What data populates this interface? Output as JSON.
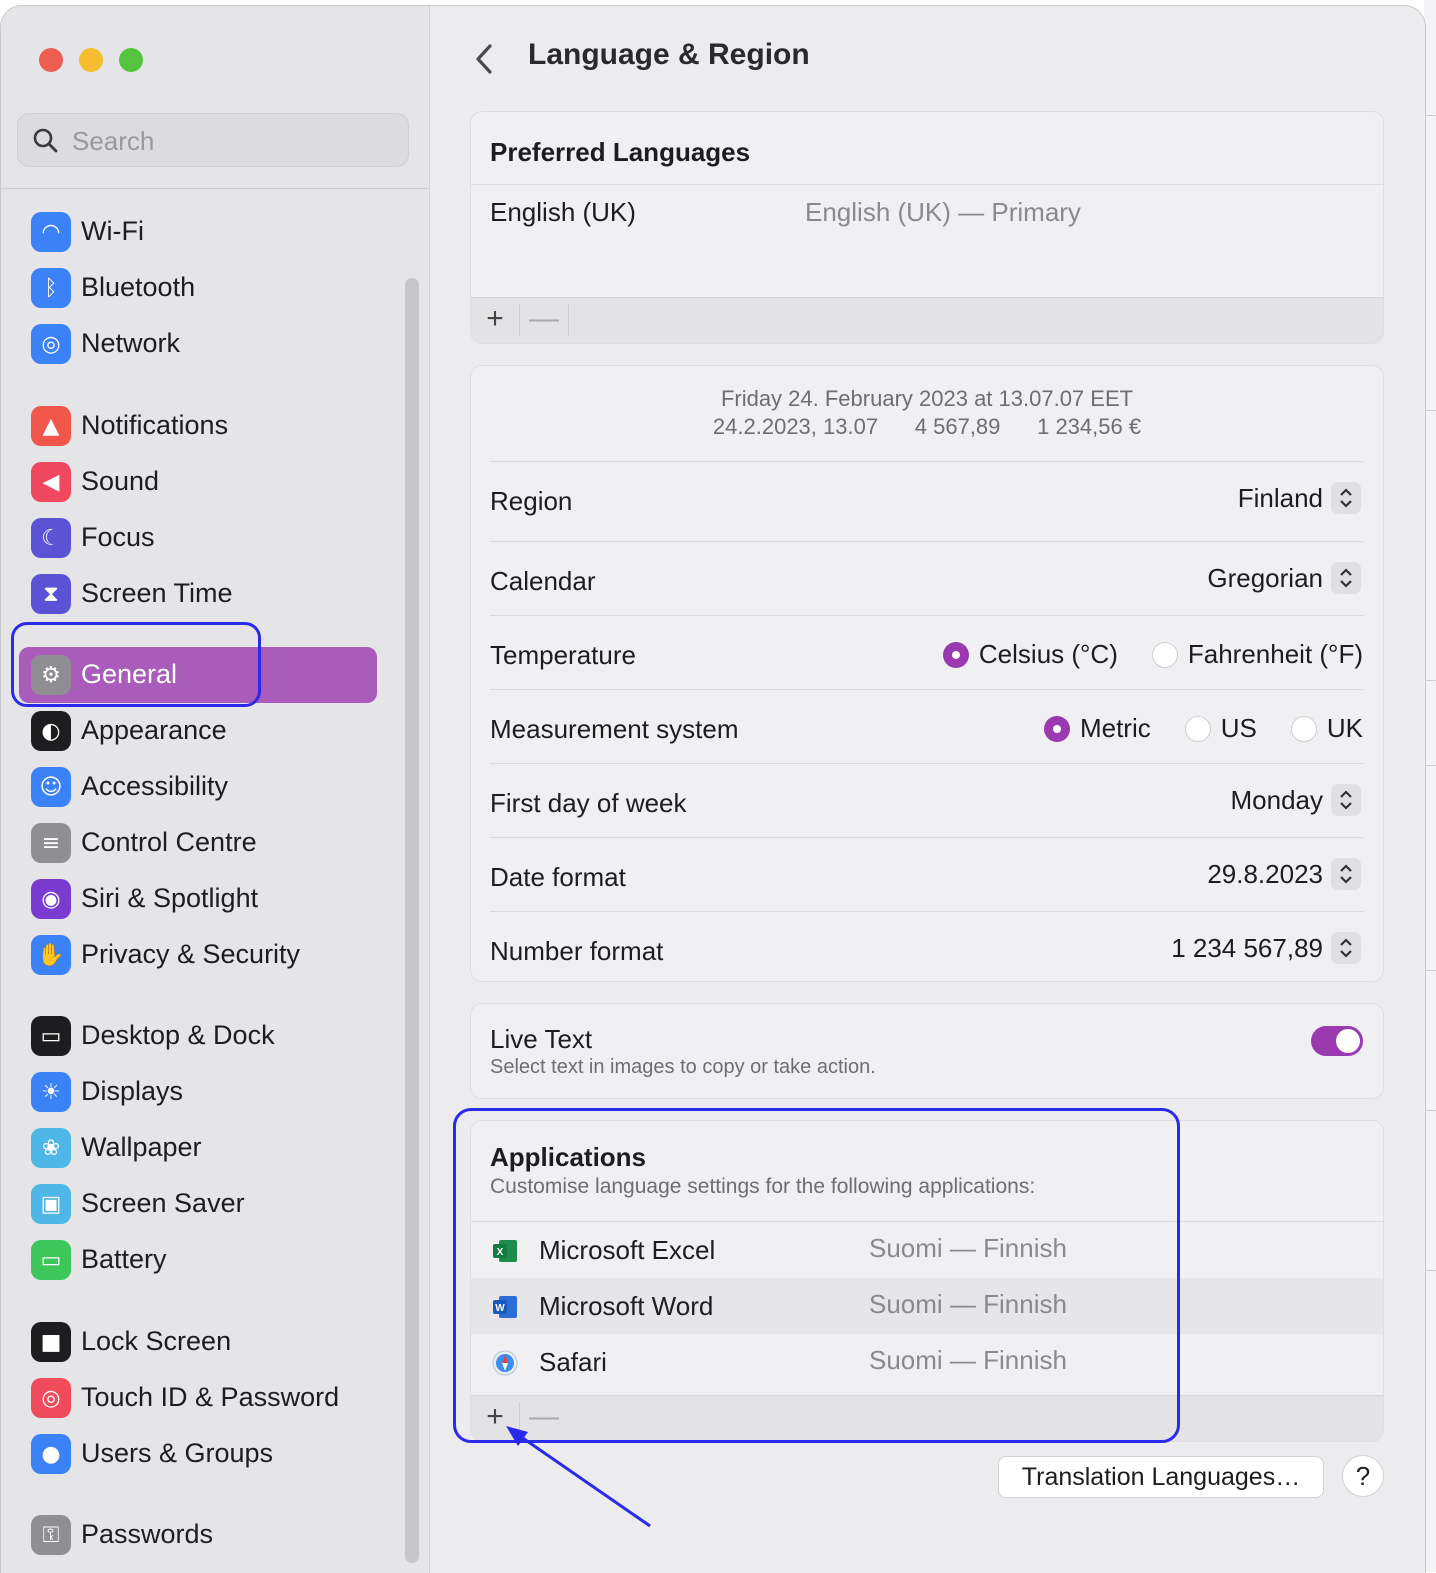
{
  "window": {
    "traffic_lights": {
      "close": "#ee5d54",
      "minimize": "#f5bd2f",
      "maximize": "#56c340"
    }
  },
  "sidebar": {
    "search_placeholder": "Search",
    "items": [
      {
        "label": "Wi-Fi",
        "icon": "wifi-icon",
        "color": "#3b82f6"
      },
      {
        "label": "Bluetooth",
        "icon": "bluetooth-icon",
        "color": "#3b82f6"
      },
      {
        "label": "Network",
        "icon": "globe-icon",
        "color": "#3b82f6"
      },
      {
        "label": "Notifications",
        "icon": "bell-icon",
        "color": "#f0564a"
      },
      {
        "label": "Sound",
        "icon": "speaker-icon",
        "color": "#f0485f"
      },
      {
        "label": "Focus",
        "icon": "moon-icon",
        "color": "#5b53d6"
      },
      {
        "label": "Screen Time",
        "icon": "hourglass-icon",
        "color": "#5b53d6"
      },
      {
        "label": "General",
        "icon": "gear-icon",
        "color": "#8e8e93",
        "selected": true
      },
      {
        "label": "Appearance",
        "icon": "appearance-icon",
        "color": "#1d1d1f"
      },
      {
        "label": "Accessibility",
        "icon": "accessibility-icon",
        "color": "#3b82f6"
      },
      {
        "label": "Control Centre",
        "icon": "toggles-icon",
        "color": "#8e8e93"
      },
      {
        "label": "Siri & Spotlight",
        "icon": "siri-icon",
        "color": "#7a3bd1"
      },
      {
        "label": "Privacy & Security",
        "icon": "hand-icon",
        "color": "#3b82f6"
      },
      {
        "label": "Desktop & Dock",
        "icon": "dock-icon",
        "color": "#1d1d1f"
      },
      {
        "label": "Displays",
        "icon": "sun-icon",
        "color": "#3b82f6"
      },
      {
        "label": "Wallpaper",
        "icon": "flower-icon",
        "color": "#4fb6e8"
      },
      {
        "label": "Screen Saver",
        "icon": "screensaver-icon",
        "color": "#4fb6e8"
      },
      {
        "label": "Battery",
        "icon": "battery-icon",
        "color": "#3dc75a"
      },
      {
        "label": "Lock Screen",
        "icon": "lock-icon",
        "color": "#1d1d1f"
      },
      {
        "label": "Touch ID & Password",
        "icon": "fingerprint-icon",
        "color": "#f04b5a"
      },
      {
        "label": "Users & Groups",
        "icon": "users-icon",
        "color": "#3b82f6"
      },
      {
        "label": "Passwords",
        "icon": "key-icon",
        "color": "#8e8e93"
      }
    ]
  },
  "main": {
    "title": "Language & Region",
    "preferred_languages": {
      "title": "Preferred Languages",
      "language": "English (UK)",
      "language_detail": "English (UK) — Primary",
      "add": "+",
      "remove": "—"
    },
    "region_card": {
      "preview_line1": "Friday 24. February 2023 at 13.07.07 EET",
      "preview_line2_a": "24.2.2023, 13.07",
      "preview_line2_b": "4 567,89",
      "preview_line2_c": "1 234,56 €",
      "region_label": "Region",
      "region_value": "Finland",
      "calendar_label": "Calendar",
      "calendar_value": "Gregorian",
      "temperature_label": "Temperature",
      "temperature_options": [
        "Celsius (°C)",
        "Fahrenheit (°F)"
      ],
      "temperature_selected": "Celsius (°C)",
      "measurement_label": "Measurement system",
      "measurement_options": [
        "Metric",
        "US",
        "UK"
      ],
      "measurement_selected": "Metric",
      "first_day_label": "First day of week",
      "first_day_value": "Monday",
      "date_format_label": "Date format",
      "date_format_value": "29.8.2023",
      "number_format_label": "Number format",
      "number_format_value": "1 234 567,89"
    },
    "live_text": {
      "title": "Live Text",
      "subtitle": "Select text in images to copy or take action.",
      "enabled": true
    },
    "applications": {
      "title": "Applications",
      "subtitle": "Customise language settings for the following applications:",
      "apps": [
        {
          "name": "Microsoft Excel",
          "language": "Suomi — Finnish",
          "icon": "excel-icon"
        },
        {
          "name": "Microsoft Word",
          "language": "Suomi — Finnish",
          "icon": "word-icon"
        },
        {
          "name": "Safari",
          "language": "Suomi — Finnish",
          "icon": "safari-icon"
        }
      ],
      "add": "+",
      "remove": "—"
    },
    "translation_button": "Translation Languages…",
    "help_button": "?"
  },
  "colors": {
    "accent": "#9a39b0",
    "sidebar_selected": "#a95cb9",
    "annotation": "#2a2bea"
  }
}
